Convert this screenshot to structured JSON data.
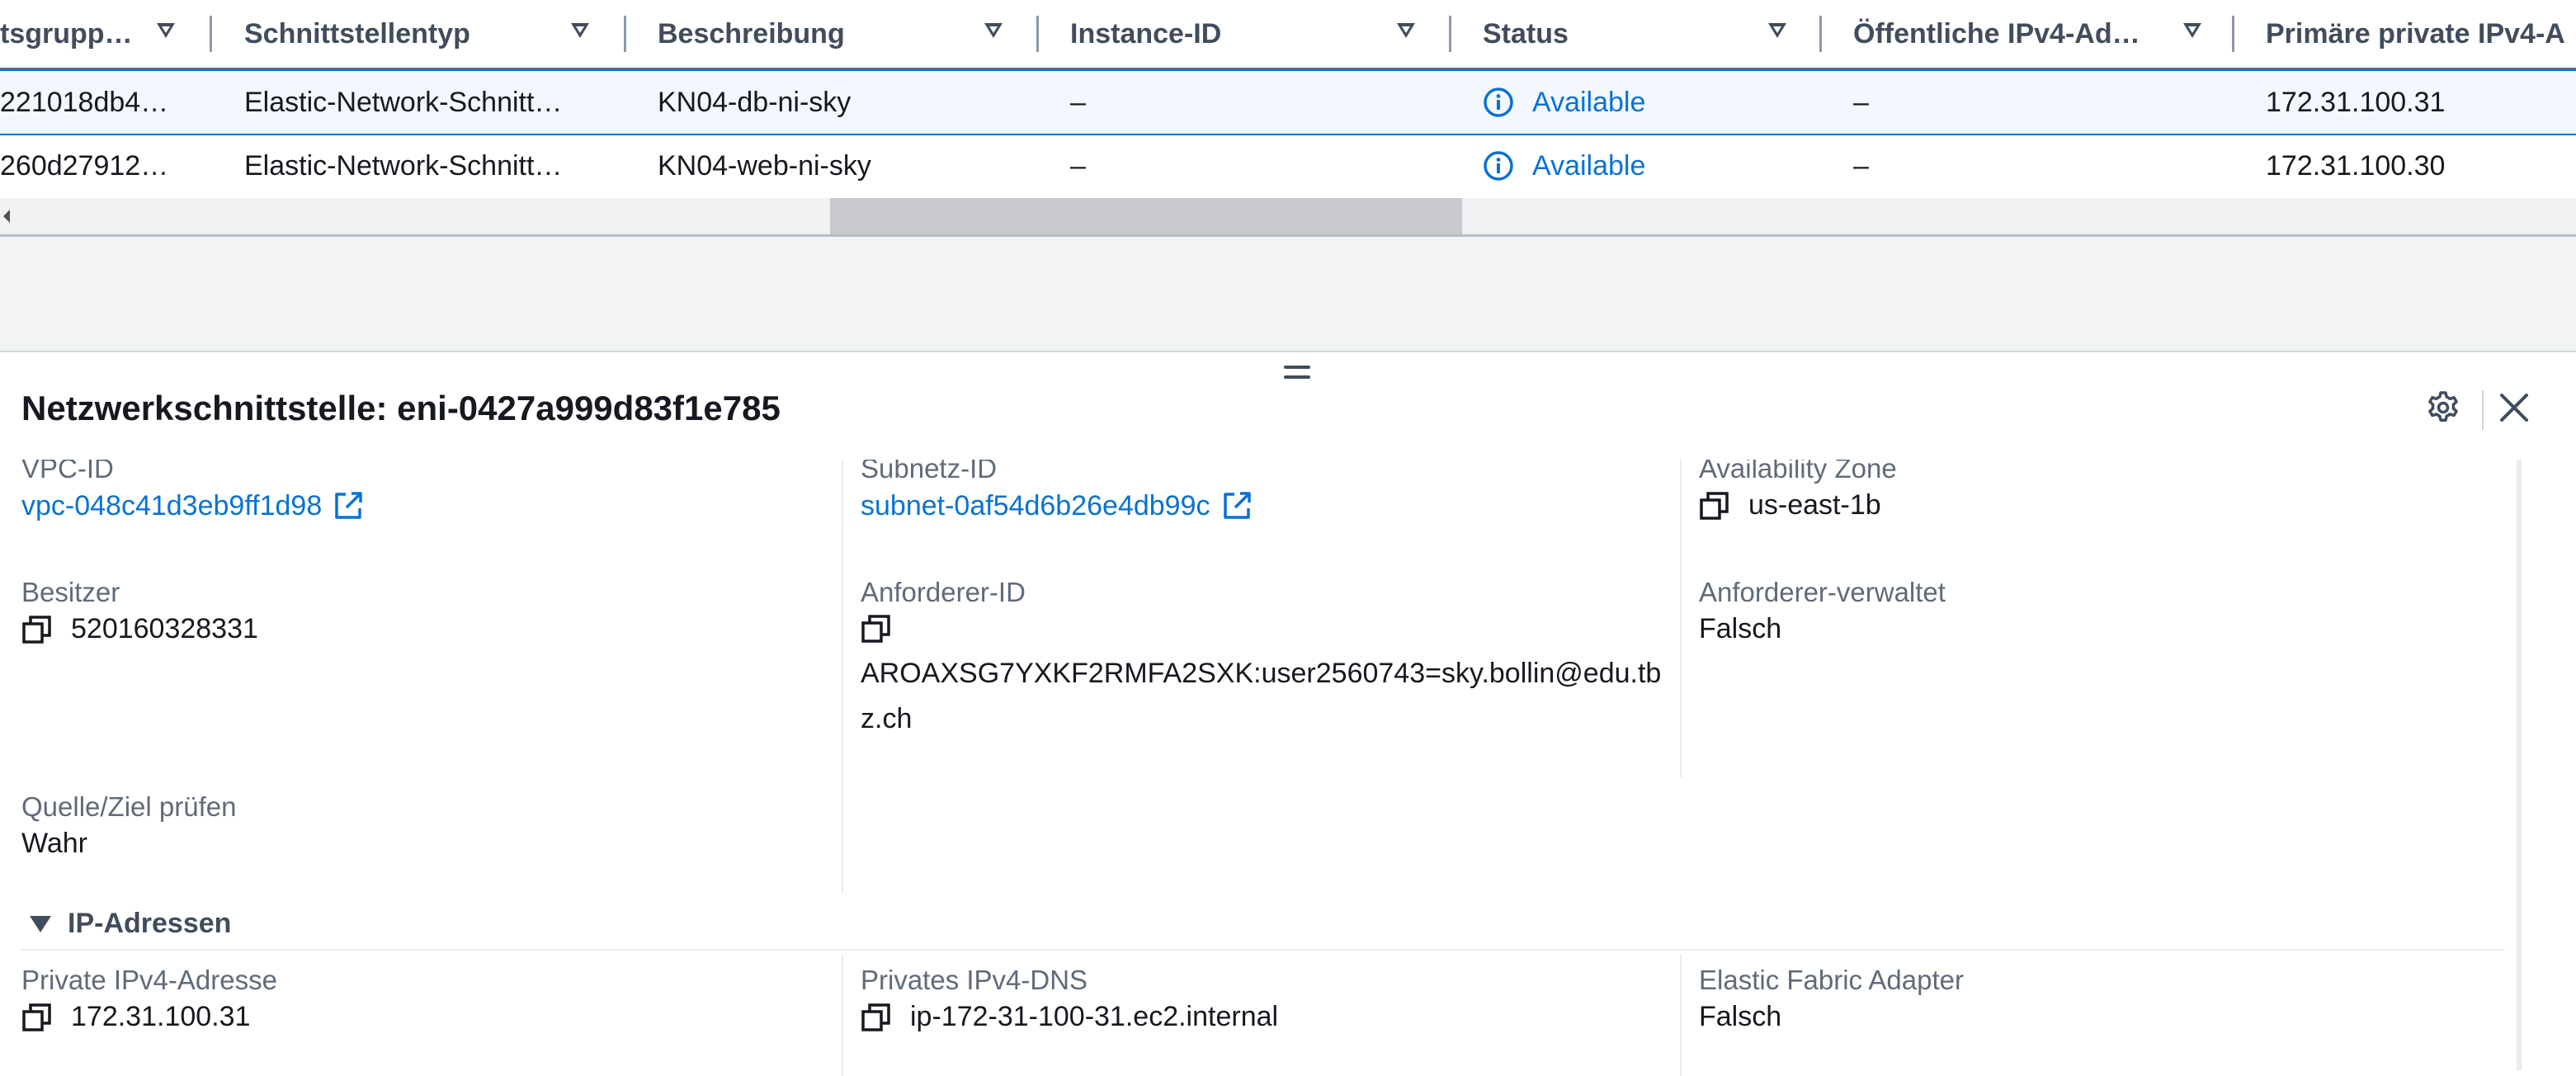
{
  "table": {
    "columns": [
      {
        "label": "tsgrupp…"
      },
      {
        "label": "Schnittstellentyp"
      },
      {
        "label": "Beschreibung"
      },
      {
        "label": "Instance-ID"
      },
      {
        "label": "Status"
      },
      {
        "label": "Öffentliche IPv4-Ad…"
      },
      {
        "label": "Primäre private IPv4-A"
      }
    ],
    "rows": [
      {
        "group": "221018db4…",
        "type": "Elastic-Network-Schnitt…",
        "description": "KN04-db-ni-sky",
        "instance": "–",
        "status": "Available",
        "public_ip": "–",
        "private_ip": "172.31.100.31",
        "selected": true
      },
      {
        "group": "260d27912…",
        "type": "Elastic-Network-Schnitt…",
        "description": "KN04-web-ni-sky",
        "instance": "–",
        "status": "Available",
        "public_ip": "–",
        "private_ip": "172.31.100.30",
        "selected": false
      }
    ]
  },
  "panel": {
    "title": "Netzwerkschnittstelle: eni-0427a999d83f1e785",
    "fields": {
      "vpc_label": "VPC-ID",
      "vpc_value": "vpc-048c41d3eb9ff1d98",
      "subnet_label": "Subnetz-ID",
      "subnet_value": "subnet-0af54d6b26e4db99c",
      "az_label": "Availability Zone",
      "az_value": "us-east-1b",
      "owner_label": "Besitzer",
      "owner_value": "520160328331",
      "requester_label": "Anforderer-ID",
      "requester_value": "AROAXSG7YXKF2RMFA2SXK:user2560743=sky.bollin@edu.tbz.ch",
      "requester_managed_label": "Anforderer-verwaltet",
      "requester_managed_value": "Falsch",
      "source_dest_label": "Quelle/Ziel prüfen",
      "source_dest_value": "Wahr"
    },
    "ip_section": {
      "title": "IP-Adressen",
      "private_ipv4_label": "Private IPv4-Adresse",
      "private_ipv4_value": "172.31.100.31",
      "private_dns_label": "Privates IPv4-DNS",
      "private_dns_value": "ip-172-31-100-31.ec2.internal",
      "efa_label": "Elastic Fabric Adapter",
      "efa_value": "Falsch"
    }
  },
  "colors": {
    "link": "#0972d3",
    "selected_row_bg": "#f2f8fd",
    "text": "#16191f",
    "label": "#5f6b7a"
  },
  "icons": [
    "sort-down-icon",
    "info-icon",
    "copy-icon",
    "external-link-icon",
    "gear-icon",
    "close-icon",
    "drag-handle-icon",
    "caret-down-icon"
  ]
}
